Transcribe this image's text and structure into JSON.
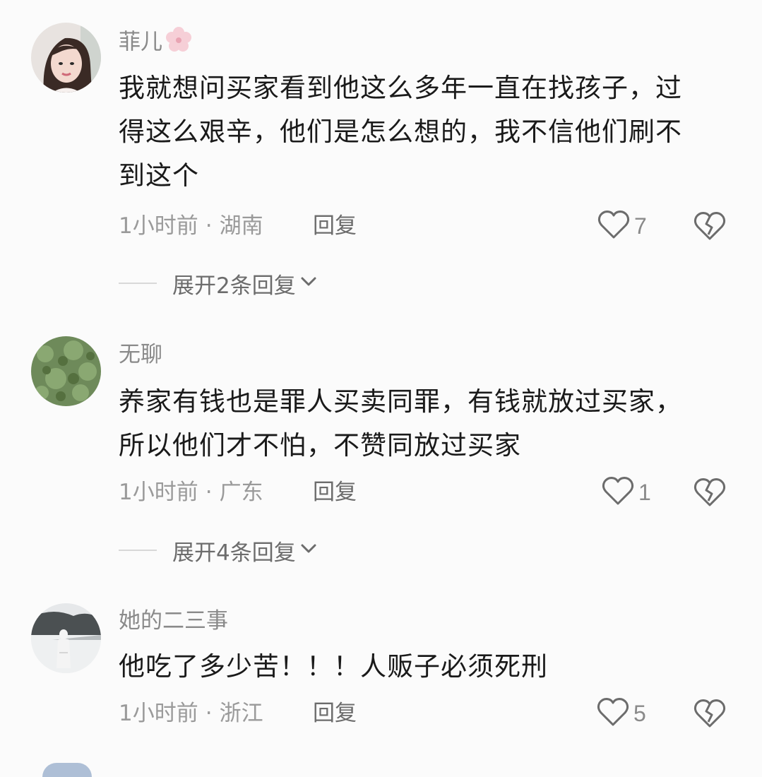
{
  "comments": [
    {
      "username": "菲儿",
      "text_lines": [
        "我就想问买家看到他这么多年一直在找孩子，过",
        "得这么艰辛，他们是怎么想的，我不信他们刷不",
        "到这个"
      ],
      "time": "1小时前",
      "location": "湖南",
      "reply_label": "回复",
      "likes": "7",
      "expand_label": "展开2条回复"
    },
    {
      "username": "无聊",
      "text_lines": [
        "养家有钱也是罪人买卖同罪，有钱就放过买家，",
        "所以他们才不怕，不赞同放过买家"
      ],
      "time": "1小时前",
      "location": "广东",
      "reply_label": "回复",
      "likes": "1",
      "expand_label": "展开4条回复"
    },
    {
      "username": "她的二三事",
      "text_lines": [
        "他吃了多少苦！！！人贩子必须死刑"
      ],
      "time": "1小时前",
      "location": "浙江",
      "reply_label": "回复",
      "likes": "5"
    }
  ],
  "separator": "·",
  "icons": {
    "like": "heart-outline-icon",
    "dislike": "broken-heart-icon",
    "expand": "chevron-down-icon",
    "badge": "flower-badge-icon"
  },
  "colors": {
    "text": "#1a1a1a",
    "meta": "#9a9a9a",
    "icon": "#6c6c6c"
  }
}
